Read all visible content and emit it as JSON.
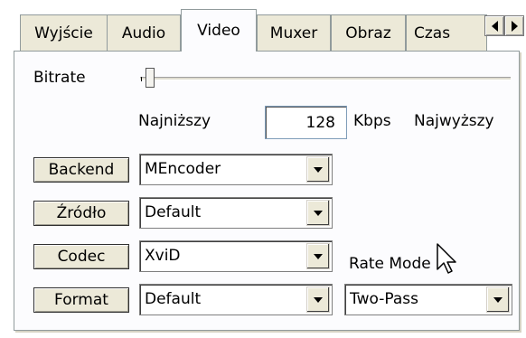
{
  "tabs": [
    {
      "label": "Wyjście"
    },
    {
      "label": "Audio"
    },
    {
      "label": "Video"
    },
    {
      "label": "Muxer"
    },
    {
      "label": "Obraz"
    },
    {
      "label": "Czas"
    }
  ],
  "bitrate": {
    "label": "Bitrate",
    "min_label": "Najniższy",
    "max_label": "Najwyższy",
    "value": "128",
    "unit": "Kbps"
  },
  "rows": [
    {
      "button": "Backend",
      "value": "MEncoder"
    },
    {
      "button": "Źródło",
      "value": "Default"
    },
    {
      "button": "Codec",
      "value": "XviD"
    },
    {
      "button": "Format",
      "value": "Default"
    }
  ],
  "rate_mode": {
    "label": "Rate Mode",
    "value": "Two-Pass"
  }
}
